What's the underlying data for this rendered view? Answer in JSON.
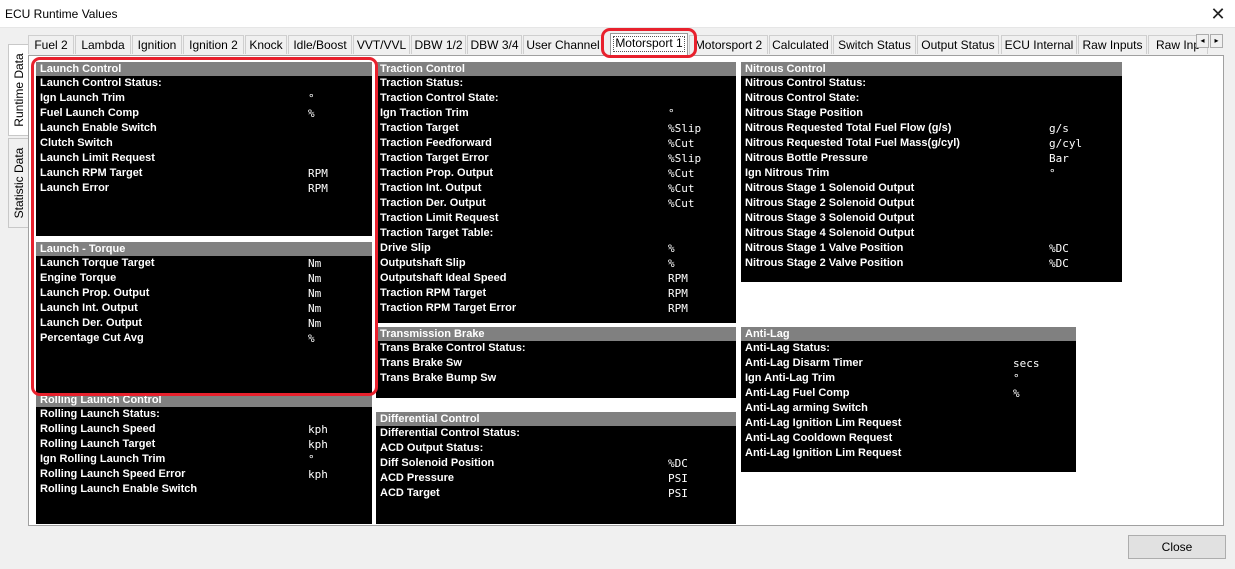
{
  "window": {
    "title": "ECU Runtime Values",
    "close_glyph": "✕"
  },
  "tabs": [
    {
      "label": "Fuel 2"
    },
    {
      "label": "Lambda"
    },
    {
      "label": "Ignition"
    },
    {
      "label": "Ignition 2"
    },
    {
      "label": "Knock"
    },
    {
      "label": "Idle/Boost"
    },
    {
      "label": "VVT/VVL"
    },
    {
      "label": "DBW 1/2"
    },
    {
      "label": "DBW 3/4"
    },
    {
      "label": "User Channel"
    },
    {
      "label": "Motorsport 1",
      "active": true
    },
    {
      "label": "Motorsport 2"
    },
    {
      "label": "Calculated"
    },
    {
      "label": "Switch Status"
    },
    {
      "label": "Output Status"
    },
    {
      "label": "ECU Internal"
    },
    {
      "label": "Raw Inputs"
    },
    {
      "label": "Raw Inp"
    }
  ],
  "tab_scroll": {
    "left": "◂",
    "right": "▸"
  },
  "side_tabs": [
    {
      "label": "Runtime Data",
      "active": true
    },
    {
      "label": "Statistic Data"
    }
  ],
  "panels": [
    {
      "title": "Launch Control",
      "rows": [
        {
          "label": "Launch Control Status:",
          "unit": ""
        },
        {
          "label": "Ign Launch Trim",
          "unit": "°"
        },
        {
          "label": "Fuel Launch Comp",
          "unit": "%"
        },
        {
          "label": "Launch Enable Switch",
          "unit": ""
        },
        {
          "label": "Clutch Switch",
          "unit": ""
        },
        {
          "label": "Launch Limit Request",
          "unit": ""
        },
        {
          "label": "Launch RPM Target",
          "unit": "RPM"
        },
        {
          "label": "Launch Error",
          "unit": "RPM"
        }
      ]
    },
    {
      "title": "Launch - Torque",
      "rows": [
        {
          "label": "Launch Torque Target",
          "unit": "Nm"
        },
        {
          "label": "Engine Torque",
          "unit": "Nm"
        },
        {
          "label": "Launch Prop. Output",
          "unit": "Nm"
        },
        {
          "label": "Launch Int. Output",
          "unit": "Nm"
        },
        {
          "label": "Launch Der. Output",
          "unit": "Nm"
        },
        {
          "label": "Percentage Cut Avg",
          "unit": "%"
        }
      ]
    },
    {
      "title": "Rolling Launch Control",
      "rows": [
        {
          "label": "Rolling Launch Status:",
          "unit": ""
        },
        {
          "label": "Rolling Launch Speed",
          "unit": "kph"
        },
        {
          "label": "Rolling Launch Target",
          "unit": "kph"
        },
        {
          "label": "Ign Rolling Launch Trim",
          "unit": "°"
        },
        {
          "label": "Rolling Launch Speed Error",
          "unit": "kph"
        },
        {
          "label": "Rolling Launch Enable Switch",
          "unit": ""
        }
      ]
    },
    {
      "title": "Traction Control",
      "rows": [
        {
          "label": "Traction Status:",
          "unit": ""
        },
        {
          "label": "Traction Control State:",
          "unit": ""
        },
        {
          "label": "Ign Traction Trim",
          "unit": "°"
        },
        {
          "label": "Traction Target",
          "unit": "%Slip"
        },
        {
          "label": "Traction Feedforward",
          "unit": "%Cut"
        },
        {
          "label": "Traction Target Error",
          "unit": "%Slip"
        },
        {
          "label": "Traction Prop. Output",
          "unit": "%Cut"
        },
        {
          "label": "Traction Int. Output",
          "unit": "%Cut"
        },
        {
          "label": "Traction Der. Output",
          "unit": "%Cut"
        },
        {
          "label": "Traction Limit Request",
          "unit": ""
        },
        {
          "label": "Traction Target Table:",
          "unit": ""
        },
        {
          "label": "Drive Slip",
          "unit": "%"
        },
        {
          "label": "Outputshaft Slip",
          "unit": "%"
        },
        {
          "label": "Outputshaft Ideal Speed",
          "unit": "RPM"
        },
        {
          "label": "Traction RPM Target",
          "unit": "RPM"
        },
        {
          "label": "Traction RPM Target Error",
          "unit": "RPM"
        }
      ]
    },
    {
      "title": "Transmission Brake",
      "rows": [
        {
          "label": "Trans Brake Control  Status:",
          "unit": ""
        },
        {
          "label": "Trans Brake Sw",
          "unit": ""
        },
        {
          "label": "Trans Brake Bump Sw",
          "unit": ""
        }
      ]
    },
    {
      "title": "Differential Control",
      "rows": [
        {
          "label": "Differential Control Status:",
          "unit": ""
        },
        {
          "label": "ACD Output Status:",
          "unit": ""
        },
        {
          "label": "Diff Solenoid Position",
          "unit": "%DC"
        },
        {
          "label": "ACD Pressure",
          "unit": "PSI"
        },
        {
          "label": "ACD Target",
          "unit": "PSI"
        }
      ]
    },
    {
      "title": "Nitrous Control",
      "rows": [
        {
          "label": "Nitrous Control Status:",
          "unit": ""
        },
        {
          "label": "Nitrous Control State:",
          "unit": ""
        },
        {
          "label": "Nitrous Stage Position",
          "unit": ""
        },
        {
          "label": "Nitrous Requested Total Fuel Flow (g/s)",
          "unit": "g/s"
        },
        {
          "label": "Nitrous Requested Total Fuel Mass(g/cyl)",
          "unit": "g/cyl"
        },
        {
          "label": "Nitrous Bottle Pressure",
          "unit": "Bar"
        },
        {
          "label": "Ign Nitrous Trim",
          "unit": "°"
        },
        {
          "label": "Nitrous Stage 1 Solenoid Output",
          "unit": ""
        },
        {
          "label": "Nitrous Stage 2 Solenoid Output",
          "unit": ""
        },
        {
          "label": "Nitrous Stage 3 Solenoid Output",
          "unit": ""
        },
        {
          "label": "Nitrous Stage 4 Solenoid Output",
          "unit": ""
        },
        {
          "label": "Nitrous Stage 1 Valve Position",
          "unit": "%DC"
        },
        {
          "label": "Nitrous Stage 2 Valve Position",
          "unit": "%DC"
        }
      ]
    },
    {
      "title": "Anti-Lag",
      "rows": [
        {
          "label": "Anti-Lag Status:",
          "unit": ""
        },
        {
          "label": "Anti-Lag Disarm Timer",
          "unit": "secs"
        },
        {
          "label": "Ign Anti-Lag Trim",
          "unit": "°"
        },
        {
          "label": "Anti-Lag Fuel  Comp",
          "unit": "%"
        },
        {
          "label": "Anti-Lag arming Switch",
          "unit": ""
        },
        {
          "label": "Anti-Lag Ignition Lim Request",
          "unit": ""
        },
        {
          "label": "Anti-Lag Cooldown Request",
          "unit": ""
        },
        {
          "label": "Anti-Lag Ignition Lim Request",
          "unit": ""
        }
      ]
    }
  ],
  "footer": {
    "close_label": "Close"
  },
  "colors": {
    "highlight": "#e8212d",
    "panel_bg": "#000000",
    "panel_header": "#808080"
  }
}
